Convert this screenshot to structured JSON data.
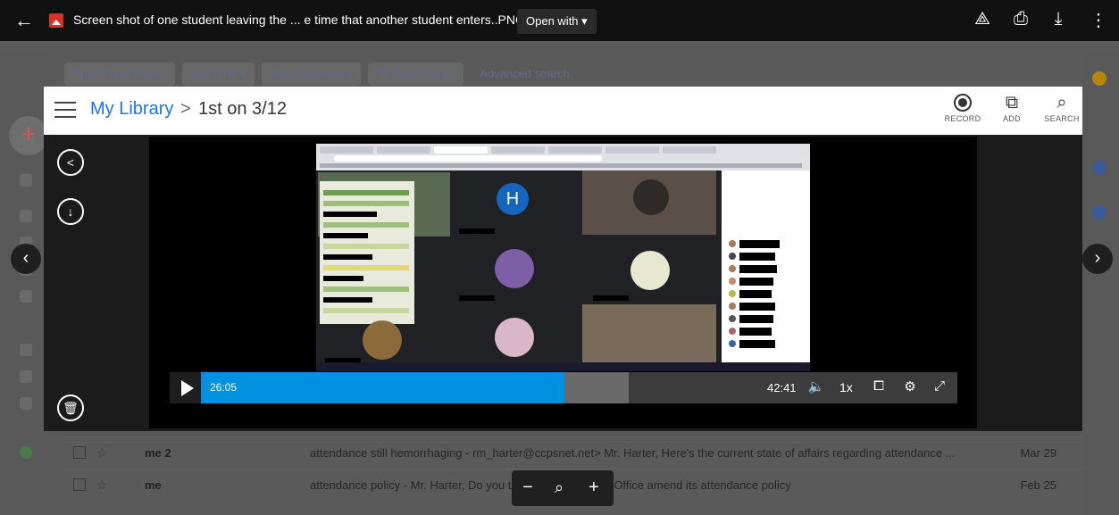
{
  "topbar": {
    "file_title": "Screen shot of one student leaving the ... e time that another student enters..PNG",
    "open_with": "Open with ▾",
    "icons": [
      "back-arrow-icon",
      "add-to-drive-icon",
      "print-icon",
      "download-icon",
      "more-vert-icon"
    ]
  },
  "gmail": {
    "chips": [
      "From Ryan Harter",
      "Any time ▾",
      "Has attachment",
      "To Ryan Harter",
      "Advanced search"
    ],
    "rows": [
      {
        "sender": "me 2",
        "snippet": "attendance still hemorrhaging - rm_harter@ccpsnet.net> Mr. Harter, Here's the current state of affairs regarding attendance ...",
        "date": "Mar 29"
      },
      {
        "sender": "me",
        "snippet": "attendance policy - Mr. Harter, Do you                          to insist that Central Office amend its attendance policy",
        "date": "Feb 25"
      }
    ]
  },
  "library": {
    "link": "My Library",
    "separator": ">",
    "current": "1st on 3/12",
    "buttons": [
      {
        "label": "RECORD",
        "icon": "record-icon"
      },
      {
        "label": "ADD",
        "icon": "add-video-icon"
      },
      {
        "label": "SEARCH",
        "icon": "search-icon"
      }
    ]
  },
  "meet": {
    "avatar_letter": "H"
  },
  "player": {
    "current_time": "26:05",
    "duration": "42:41",
    "speed": "1x",
    "progress": 0.48,
    "buffered": 0.085
  },
  "zoom": {
    "minus": "−",
    "plus": "+"
  }
}
